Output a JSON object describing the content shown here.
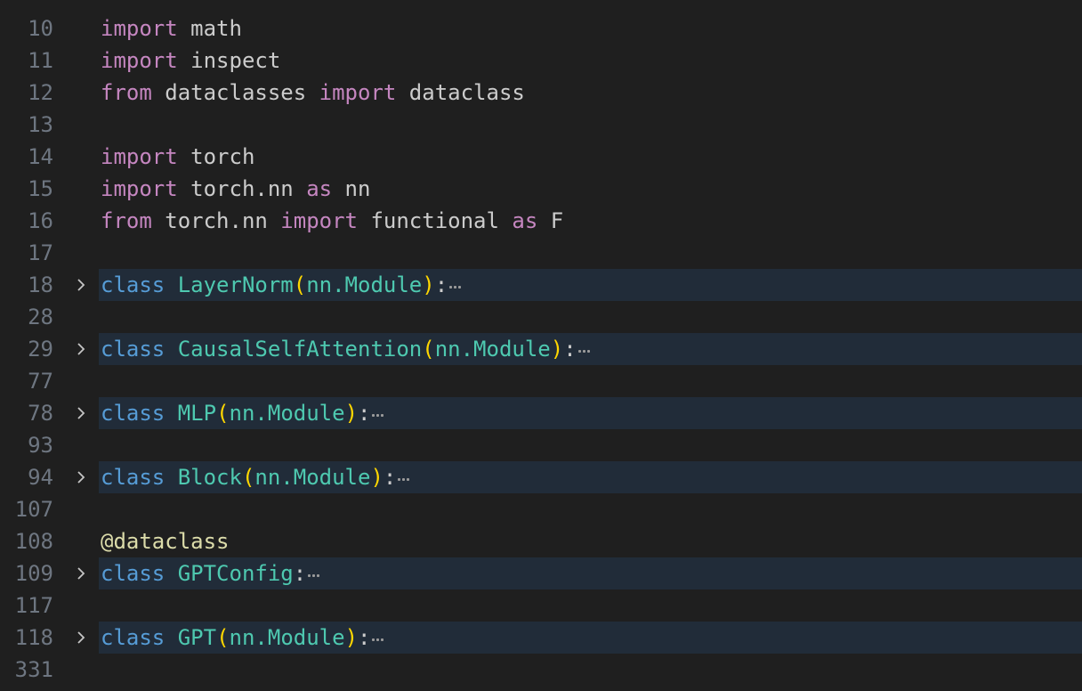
{
  "theme": {
    "background": "#1f1f1f",
    "folded_highlight": "#212c39",
    "line_number": "#6e7681",
    "keyword_import": "#c586c0",
    "keyword_class": "#569cd6",
    "class_name": "#4ec9b0",
    "bracket": "#ffd700",
    "decorator": "#dcdcaa"
  },
  "editor": {
    "lines": [
      {
        "num": "10",
        "tokens": [
          "import",
          " math"
        ]
      },
      {
        "num": "11",
        "tokens": [
          "import",
          " inspect"
        ]
      },
      {
        "num": "12",
        "tokens": [
          "from",
          " dataclasses ",
          "import",
          " dataclass"
        ]
      },
      {
        "num": "13",
        "tokens": []
      },
      {
        "num": "14",
        "tokens": [
          "import",
          " torch"
        ]
      },
      {
        "num": "15",
        "tokens": [
          "import",
          " torch.nn ",
          "as",
          " nn"
        ]
      },
      {
        "num": "16",
        "tokens": [
          "from",
          " torch.nn ",
          "import",
          " functional ",
          "as",
          " F"
        ]
      },
      {
        "num": "17",
        "tokens": []
      },
      {
        "num": "18",
        "folded": true,
        "class_kw": "class",
        "class_name": "LayerNorm",
        "base_open": "(",
        "base": "nn.Module",
        "base_close": ")",
        "colon": ":"
      },
      {
        "num": "28",
        "tokens": []
      },
      {
        "num": "29",
        "folded": true,
        "class_kw": "class",
        "class_name": "CausalSelfAttention",
        "base_open": "(",
        "base": "nn.Module",
        "base_close": ")",
        "colon": ":"
      },
      {
        "num": "77",
        "tokens": []
      },
      {
        "num": "78",
        "folded": true,
        "class_kw": "class",
        "class_name": "MLP",
        "base_open": "(",
        "base": "nn.Module",
        "base_close": ")",
        "colon": ":"
      },
      {
        "num": "93",
        "tokens": []
      },
      {
        "num": "94",
        "folded": true,
        "class_kw": "class",
        "class_name": "Block",
        "base_open": "(",
        "base": "nn.Module",
        "base_close": ")",
        "colon": ":"
      },
      {
        "num": "107",
        "tokens": []
      },
      {
        "num": "108",
        "decorator": "@dataclass"
      },
      {
        "num": "109",
        "folded": true,
        "class_kw": "class",
        "class_name": "GPTConfig",
        "colon": ":"
      },
      {
        "num": "117",
        "tokens": []
      },
      {
        "num": "118",
        "folded": true,
        "class_kw": "class",
        "class_name": "GPT",
        "base_open": "(",
        "base": "nn.Module",
        "base_close": ")",
        "colon": ":"
      },
      {
        "num": "331",
        "tokens": []
      }
    ],
    "icons": {
      "fold": "chevron-right-icon",
      "collapsed": "ellipsis-icon"
    }
  }
}
